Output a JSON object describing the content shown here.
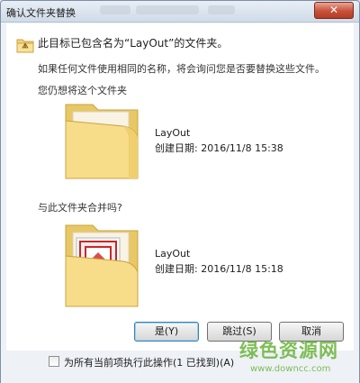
{
  "window": {
    "title": "确认文件夹替换",
    "close_glyph": "✕"
  },
  "message": {
    "main": "此目标已包含名为“LayOut”的文件夹。",
    "sub": "如果任何文件使用相同的名称，将会询问您是否要替换这些文件。",
    "want": "您仍想将这个文件夹",
    "merge": "与此文件夹合并吗?"
  },
  "source_folder": {
    "name": "LayOut",
    "date": "创建日期: 2016/11/8 15:38"
  },
  "target_folder": {
    "name": "LayOut",
    "date": "创建日期: 2016/11/8 15:18"
  },
  "buttons": {
    "yes": "是(Y)",
    "skip": "跳过(S)",
    "cancel": "取消"
  },
  "checkbox": {
    "label": "为所有当前项执行此操作(1 已找到)(A)",
    "checked": false
  },
  "watermark": {
    "text": "绿色资源网",
    "url": "www.downcc.com"
  },
  "colors": {
    "accent": "#3c7fb1",
    "close": "#c6513a",
    "watermark": "#69b33b"
  },
  "icons": {
    "warning": "warning-folder-icon",
    "source": "folder-icon",
    "target": "folder-with-layout-icon"
  }
}
